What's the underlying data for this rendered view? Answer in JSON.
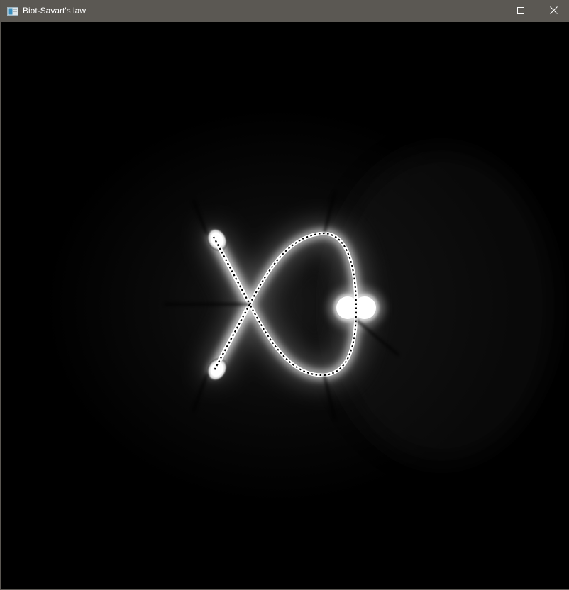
{
  "window": {
    "title": "Biot-Savart's law",
    "icon": "app-window-icon",
    "controls": {
      "minimize_icon": "minimize-icon",
      "maximize_icon": "maximize-icon",
      "close_icon": "close-icon"
    }
  },
  "colors": {
    "titlebar": "#5b5853",
    "background": "#000000",
    "field_glow": "#ffffff"
  }
}
